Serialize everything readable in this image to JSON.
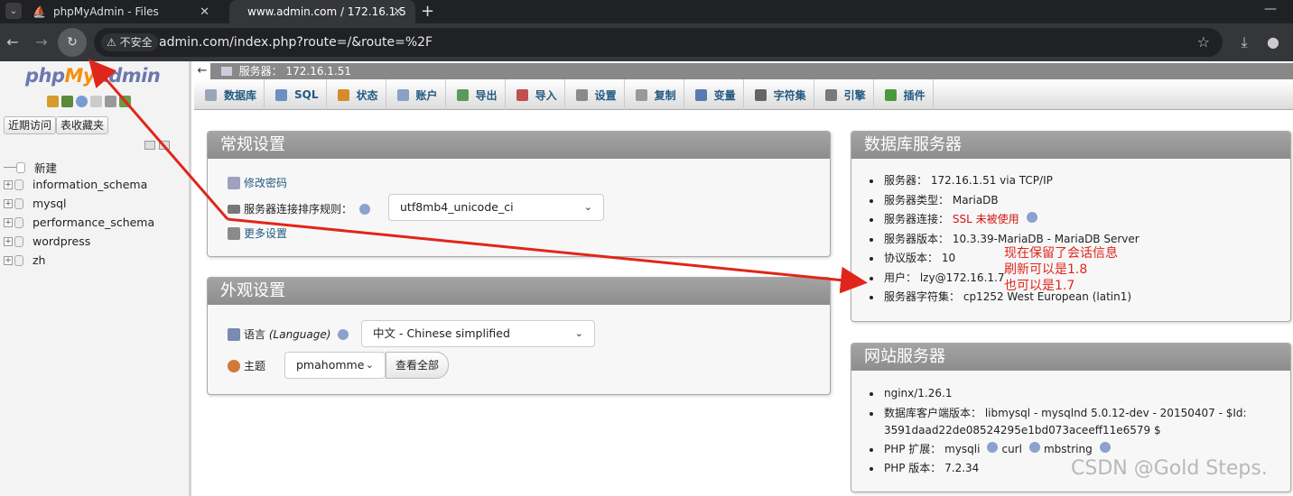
{
  "browser": {
    "tabs": [
      {
        "title": "phpMyAdmin - Files"
      },
      {
        "title": "www.admin.com / 172.16.1.5"
      }
    ],
    "insecure_label": "不安全",
    "url": "admin.com/index.php?route=/&route=%2F"
  },
  "nav": {
    "logo": {
      "php": "php",
      "my": "My",
      "admin": "Admin"
    },
    "recent_button": "近期访问",
    "favorites_button": "表收藏夹",
    "new_item": "新建",
    "databases": [
      "information_schema",
      "mysql",
      "performance_schema",
      "wordpress",
      "zh"
    ]
  },
  "serverbar": {
    "label": "服务器：",
    "value": "172.16.1.51"
  },
  "menu": [
    {
      "label": "数据库",
      "icon": "database-icon",
      "color": "#9aa6b8"
    },
    {
      "label": "SQL",
      "icon": "sql-icon",
      "color": "#6c8fc4"
    },
    {
      "label": "状态",
      "icon": "status-icon",
      "color": "#d68c2b"
    },
    {
      "label": "账户",
      "icon": "accounts-icon",
      "color": "#8aa0c6"
    },
    {
      "label": "导出",
      "icon": "export-icon",
      "color": "#5a9a5a"
    },
    {
      "label": "导入",
      "icon": "import-icon",
      "color": "#c05050"
    },
    {
      "label": "设置",
      "icon": "settings-icon",
      "color": "#8a8a8a"
    },
    {
      "label": "复制",
      "icon": "replication-icon",
      "color": "#999999"
    },
    {
      "label": "变量",
      "icon": "variables-icon",
      "color": "#5a7ab0"
    },
    {
      "label": "字符集",
      "icon": "charset-icon",
      "color": "#666666"
    },
    {
      "label": "引擎",
      "icon": "engines-icon",
      "color": "#7a7a7a"
    },
    {
      "label": "插件",
      "icon": "plugins-icon",
      "color": "#4a9a3a"
    }
  ],
  "general_settings": {
    "title": "常规设置",
    "change_password": "修改密码",
    "collation_label": "服务器连接排序规则：",
    "collation_value": "utf8mb4_unicode_ci",
    "more_settings": "更多设置"
  },
  "appearance": {
    "title": "外观设置",
    "language_label": "语言",
    "language_label_en": "(Language)",
    "language_value": "中文 - Chinese simplified",
    "theme_label": "主题",
    "theme_value": "pmahomme",
    "view_all": "查看全部"
  },
  "db_server": {
    "title": "数据库服务器",
    "items": [
      {
        "label": "服务器：",
        "value": "172.16.1.51 via TCP/IP"
      },
      {
        "label": "服务器类型：",
        "value": "MariaDB"
      },
      {
        "label": "服务器连接：",
        "value": "SSL 未被使用"
      },
      {
        "label": "服务器版本：",
        "value": "10.3.39-MariaDB - MariaDB Server"
      },
      {
        "label": "协议版本：",
        "value": "10"
      },
      {
        "label": "用户：",
        "value": "lzy@172.16.1.7"
      },
      {
        "label": "服务器字符集：",
        "value": "cp1252 West European (latin1)"
      }
    ]
  },
  "web_server": {
    "title": "网站服务器",
    "item1": "nginx/1.26.1",
    "client_label": "数据库客户端版本：",
    "client_value_1": "libmysql - mysqlnd 5.0.12-dev - 20150407 - $Id:",
    "client_value_2": "3591daad22de08524295e1bd073aceeff11e6579 $",
    "php_ext_label": "PHP 扩展：",
    "php_ext": [
      "mysqli",
      "curl",
      "mbstring"
    ],
    "php_version_label": "PHP 版本：",
    "php_version": "7.2.34"
  },
  "annotation": [
    "现在保留了会话信息",
    "刷新可以是1.8",
    "也可以是1.7"
  ],
  "watermark": "CSDN @Gold Steps.",
  "colors": {
    "annotation": "#e0261b",
    "link": "#235a81",
    "panel_header": "#999999"
  }
}
